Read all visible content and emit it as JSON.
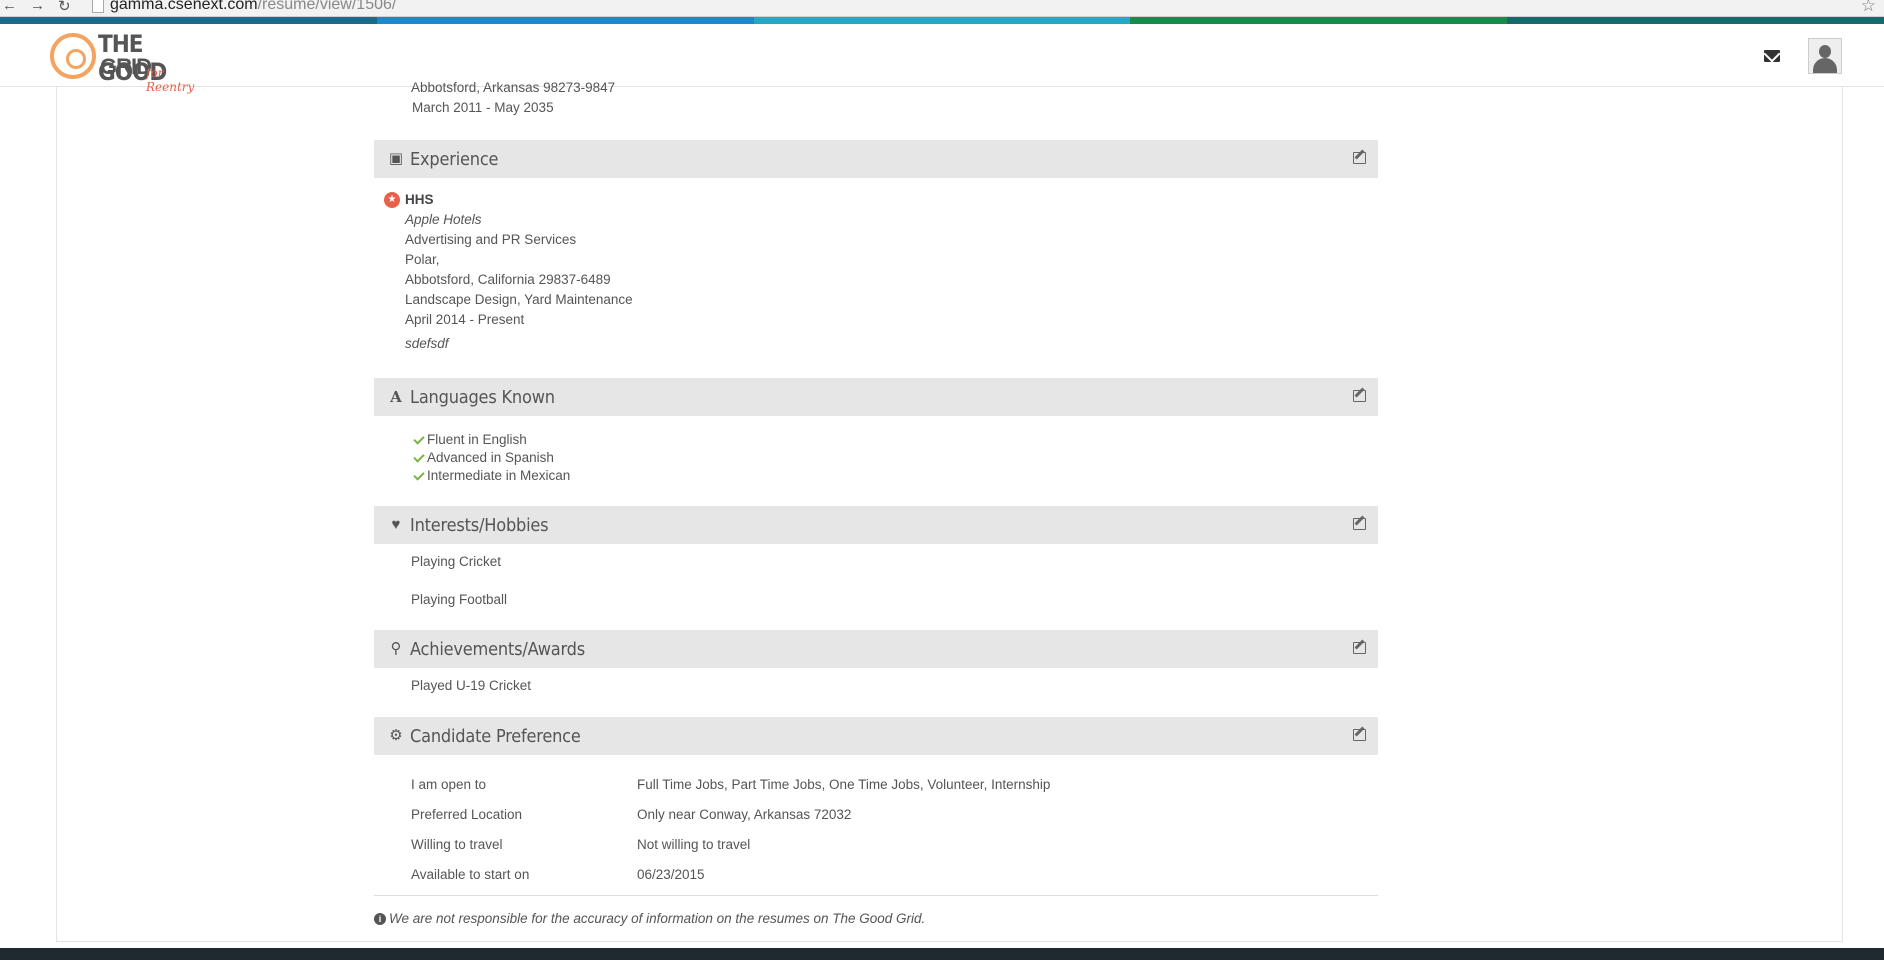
{
  "browser": {
    "url_host": "gamma.csenext.com",
    "url_path": "/resume/view/1506/"
  },
  "header": {
    "logo_line1": "THE GOOD",
    "logo_line2": "GRID",
    "logo_tag": "for Reentry"
  },
  "stripe_colors": [
    "#1b6b8a",
    "#1e88c8",
    "#29a6c4",
    "#1a8a4a",
    "#156b6b"
  ],
  "education_tail": {
    "address": "Abbotsford, Arkansas  98273-9847",
    "dates": "March 2011 - May 2035"
  },
  "experience": {
    "title": "Experience",
    "job_title": "HHS",
    "company": "Apple Hotels",
    "industry": "Advertising and PR Services",
    "city": "Polar,",
    "address": "Abbotsford, California  29837-6489",
    "skills": "Landscape Design, Yard Maintenance",
    "dates": "April 2014 - Present",
    "description": "sdefsdf"
  },
  "languages": {
    "title": "Languages Known",
    "items": [
      "Fluent in English",
      "Advanced in Spanish",
      "Intermediate in Mexican"
    ]
  },
  "interests": {
    "title": "Interests/Hobbies",
    "items": [
      "Playing Cricket",
      "Playing Football"
    ]
  },
  "achievements": {
    "title": "Achievements/Awards",
    "items": [
      "Played U-19 Cricket"
    ]
  },
  "preference": {
    "title": "Candidate Preference",
    "rows": [
      {
        "label": "I am open to",
        "value": "Full Time Jobs, Part Time Jobs, One Time Jobs, Volunteer, Internship"
      },
      {
        "label": "Preferred Location",
        "value": "Only near Conway, Arkansas 72032"
      },
      {
        "label": "Willing to travel",
        "value": "Not willing to travel"
      },
      {
        "label": "Available to start on",
        "value": "06/23/2015"
      }
    ]
  },
  "disclaimer": "We are not responsible for the accuracy of information on the resumes on The Good Grid.",
  "colors": {
    "section_bg": "#e6e6e6",
    "accent_red": "#e8604a",
    "check_green": "#7cb342",
    "footer_dark": "#1f2a2e"
  }
}
